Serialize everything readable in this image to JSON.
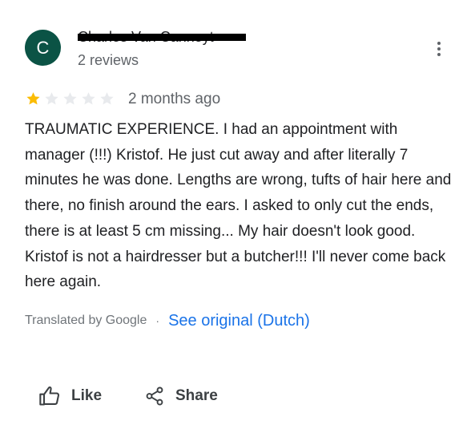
{
  "reviewer": {
    "avatar_letter": "C",
    "avatar_color": "#0b5345",
    "name": "Charles Van Canneyt",
    "review_count": "2 reviews"
  },
  "rating": {
    "value": 1,
    "max": 5,
    "filled_color": "#fbbc04",
    "empty_color": "#e8eaed"
  },
  "time_ago": "2 months ago",
  "review": {
    "text": "TRAUMATIC EXPERIENCE. I had an appointment with manager (!!!) Kristof. He just cut away and after literally 7 minutes he was done. Lengths are wrong, tufts of hair here and there, no finish around the ears. I asked to only cut the ends, there is at least 5 cm missing... My hair doesn't look good. Kristof is not a hairdresser but a butcher!!! I'll never come back here again."
  },
  "translation": {
    "translated_by": "Translated by Google",
    "separator": "·",
    "see_original": "See original (Dutch)"
  },
  "actions": {
    "like_label": "Like",
    "like_icon": "thumbs-up-icon",
    "share_label": "Share",
    "share_icon": "share-icon"
  },
  "menu": {
    "icon": "more-vert-icon"
  },
  "colors": {
    "link": "#1a73e8",
    "secondary_text": "#5f6368"
  }
}
